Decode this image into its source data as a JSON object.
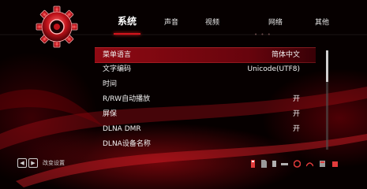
{
  "tabs": {
    "system": "系统",
    "audio": "声音",
    "video": "视频",
    "network": "网络",
    "other": "其他"
  },
  "faded_text": "• • •",
  "menu": {
    "items": [
      {
        "label": "菜单语言",
        "value": "简体中文"
      },
      {
        "label": "文字编码",
        "value": "Unicode(UTF8)"
      },
      {
        "label": "时间",
        "value": ""
      },
      {
        "label": "R/RW自动播放",
        "value": "开"
      },
      {
        "label": "屏保",
        "value": "开"
      },
      {
        "label": "DLNA DMR",
        "value": "开"
      },
      {
        "label": "DLNA设备名称",
        "value": ""
      }
    ]
  },
  "hint": {
    "text": "改变设置"
  },
  "status_icons": [
    "usb-icon",
    "sd-card-icon",
    "disk-icon",
    "network-icon",
    "wifi-icon",
    "dvd-icon",
    "hdd-icon",
    "box-icon"
  ],
  "colors": {
    "accent": "#d4141c",
    "background": "#060000",
    "text": "#f2f2f2"
  }
}
